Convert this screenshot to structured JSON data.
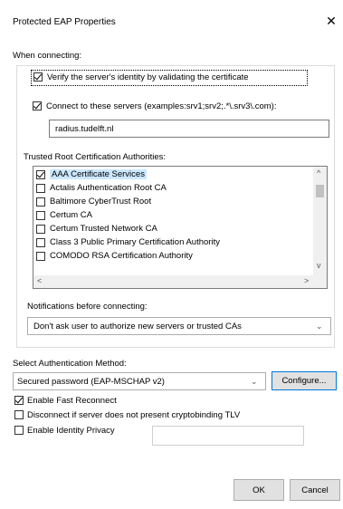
{
  "window": {
    "title": "Protected EAP Properties",
    "close_glyph": "✕"
  },
  "connecting": {
    "heading": "When connecting:",
    "verify_label": "Verify the server's identity by validating the certificate",
    "verify_checked": true,
    "connect_label": "Connect to these servers (examples:srv1;srv2;.*\\.srv3\\.com):",
    "connect_checked": true,
    "servers_value": "radius.tudelft.nl"
  },
  "root_ca": {
    "heading": "Trusted Root Certification Authorities:",
    "items": [
      {
        "label": "AAA Certificate Services",
        "checked": true
      },
      {
        "label": "Actalis Authentication Root CA",
        "checked": false
      },
      {
        "label": "Baltimore CyberTrust Root",
        "checked": false
      },
      {
        "label": "Certum CA",
        "checked": false
      },
      {
        "label": "Certum Trusted Network CA",
        "checked": false
      },
      {
        "label": "Class 3 Public Primary Certification Authority",
        "checked": false
      },
      {
        "label": "COMODO RSA Certification Authority",
        "checked": false
      }
    ],
    "scroll_up": "^",
    "scroll_down": "v",
    "scroll_left": "<",
    "scroll_right": ">"
  },
  "notifications": {
    "heading": "Notifications before connecting:",
    "selected": "Don't ask user to authorize new servers or trusted CAs"
  },
  "auth": {
    "heading": "Select Authentication Method:",
    "selected": "Secured password (EAP-MSCHAP v2)",
    "configure_label": "Configure..."
  },
  "options": {
    "fast_reconnect": {
      "label": "Enable Fast Reconnect",
      "checked": true
    },
    "disconnect_tlv": {
      "label": "Disconnect if server does not present cryptobinding TLV",
      "checked": false
    },
    "identity_privacy": {
      "label": "Enable Identity Privacy",
      "checked": false,
      "value": ""
    }
  },
  "footer": {
    "ok_label": "OK",
    "cancel_label": "Cancel"
  },
  "colors": {
    "accent": "#0078d7",
    "selection": "#cce8ff"
  }
}
